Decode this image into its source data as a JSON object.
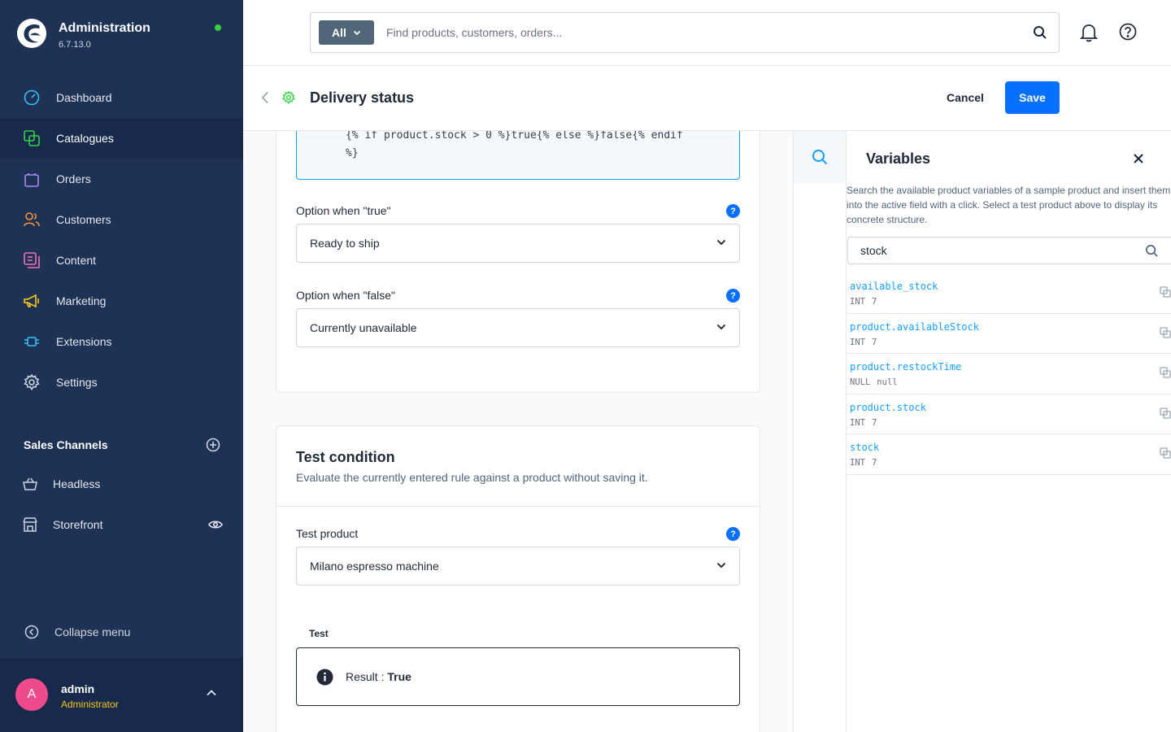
{
  "app": {
    "name": "Administration",
    "version": "6.7.13.0",
    "status_color": "#37d046"
  },
  "nav": {
    "items": [
      {
        "label": "Dashboard",
        "icon": "dashboard-icon",
        "active": false
      },
      {
        "label": "Catalogues",
        "icon": "catalogue-icon",
        "active": true
      },
      {
        "label": "Orders",
        "icon": "orders-icon",
        "active": false
      },
      {
        "label": "Customers",
        "icon": "customers-icon",
        "active": false
      },
      {
        "label": "Content",
        "icon": "content-icon",
        "active": false
      },
      {
        "label": "Marketing",
        "icon": "marketing-icon",
        "active": false
      },
      {
        "label": "Extensions",
        "icon": "extensions-icon",
        "active": false
      },
      {
        "label": "Settings",
        "icon": "gear-icon",
        "active": false
      }
    ]
  },
  "sales_channels": {
    "title": "Sales Channels",
    "items": [
      {
        "label": "Headless",
        "icon": "basket-icon"
      },
      {
        "label": "Storefront",
        "icon": "storefront-icon"
      }
    ]
  },
  "collapse_label": "Collapse menu",
  "user": {
    "initial": "A",
    "name": "admin",
    "role": "Administrator"
  },
  "search": {
    "type_label": "All",
    "placeholder": "Find products, customers, orders..."
  },
  "page": {
    "title": "Delivery status",
    "cancel_label": "Cancel",
    "save_label": "Save"
  },
  "rule": {
    "code": "{% if product.stock > 0 %}true{% else %}false{% endif\n%}",
    "true_label": "Option when \"true\"",
    "true_value": "Ready to ship",
    "false_label": "Option when \"false\"",
    "false_value": "Currently unavailable"
  },
  "test": {
    "title": "Test condition",
    "subtitle": "Evaluate the currently entered rule against a product without saving it.",
    "product_label": "Test product",
    "product_value": "Milano espresso machine",
    "test_label": "Test",
    "result_prefix": "Result : ",
    "result_value": "True"
  },
  "variables": {
    "title": "Variables",
    "description": "Search the available product variables of a sample product and insert them into the active field with a click. Select a test product above to display its concrete structure.",
    "search_value": "stock",
    "items": [
      {
        "name": "available_stock",
        "type": "INT",
        "value": "7"
      },
      {
        "name": "product.availableStock",
        "type": "INT",
        "value": "7"
      },
      {
        "name": "product.restockTime",
        "type": "NULL",
        "value": "null"
      },
      {
        "name": "product.stock",
        "type": "INT",
        "value": "7"
      },
      {
        "name": "stock",
        "type": "INT",
        "value": "7"
      }
    ]
  },
  "colors": {
    "sidebar": "#1e3256",
    "primary": "#0870ff",
    "link": "#189eff",
    "avatar": "#ee4b8b",
    "role": "#f5c518"
  }
}
